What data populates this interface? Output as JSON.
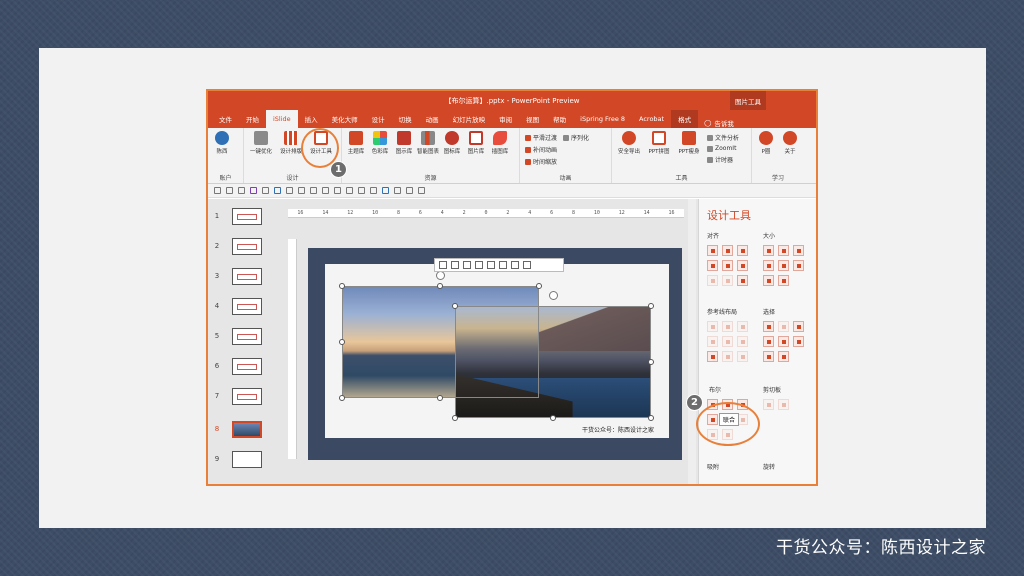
{
  "brand_footer": "干货公众号：陈西设计之家",
  "window": {
    "title": "【布尔运算】.pptx - PowerPoint Preview",
    "context_group": "图片工具"
  },
  "tabs": [
    "文件",
    "开始",
    "iSlide",
    "插入",
    "美化大师",
    "设计",
    "切换",
    "动画",
    "幻灯片放映",
    "审阅",
    "视图",
    "帮助",
    "iSpring Free 8",
    "Acrobat",
    "格式"
  ],
  "active_tab": "iSlide",
  "tell_me": "告诉我",
  "ribbon": {
    "account": {
      "btn": "陈西",
      "label": "账户"
    },
    "design": {
      "label": "设计",
      "buttons": [
        "一键优化",
        "设计排版",
        "设计工具"
      ]
    },
    "resources": {
      "label": "资源",
      "buttons": [
        "主题库",
        "色彩库",
        "图示库",
        "智能图表",
        "图标库",
        "图片库",
        "插图库"
      ]
    },
    "animation": {
      "label": "动画",
      "items": [
        "平滑过渡",
        "序列化",
        "补间动画",
        "时间缩放"
      ]
    },
    "tools": {
      "label": "工具",
      "buttons": [
        "安全导出",
        "PPT拼图",
        "PPT瘦身"
      ],
      "items": [
        "文件分析",
        "ZoomIt",
        "计时器"
      ]
    },
    "learn": {
      "label": "学习",
      "buttons": [
        "P圈",
        "关于"
      ]
    }
  },
  "ruler": {
    "top_ticks": [
      "16",
      "14",
      "12",
      "10",
      "8",
      "6",
      "4",
      "2",
      "0",
      "2",
      "4",
      "6",
      "8",
      "10",
      "12",
      "14",
      "16"
    ]
  },
  "slides": [
    "1",
    "2",
    "3",
    "4",
    "5",
    "6",
    "7",
    "8",
    "9"
  ],
  "active_slide": "8",
  "slide_caption": "干货公众号：陈西设计之家",
  "pane": {
    "title": "设计工具",
    "align": "对齐",
    "size": "大小",
    "guides": "参考线布局",
    "select": "选择",
    "boolean": "布尔",
    "clipboard": "剪切板",
    "snap": "吸附",
    "rotate": "旋转",
    "tooltip": "联合"
  },
  "callouts": {
    "one": "1",
    "two": "2"
  },
  "colors": {
    "accent": "#d24726",
    "callout": "#e9803a",
    "background": "#3d4d66"
  }
}
